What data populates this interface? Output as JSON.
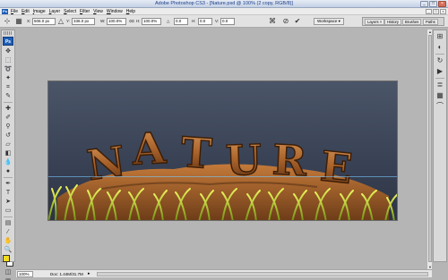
{
  "window": {
    "title": "Adobe Photoshop CS3 - [Nature.psd @ 100% (2 copy, RGB/8)]"
  },
  "menubar": {
    "logo": "Ps",
    "items": [
      "File",
      "Edit",
      "Image",
      "Layer",
      "Select",
      "Filter",
      "View",
      "Window",
      "Help"
    ]
  },
  "options": {
    "x_label": "X:",
    "x_value": "506.0 px",
    "y_label": "Y:",
    "y_value": "336.0 px",
    "w_label": "W:",
    "w_value": "100.0%",
    "h_label": "H:",
    "h_value": "100.0%",
    "angle_label": "△",
    "angle_value": "0.0",
    "hskew_label": "H:",
    "hskew_value": "0.0",
    "vskew_label": "V:",
    "vskew_value": "0.0",
    "workspace_label": "Workspace ▾",
    "panel_tabs": [
      "Layers ×",
      "History",
      "Brushes",
      "Paths"
    ]
  },
  "toolbox": {
    "logo": "Ps"
  },
  "status": {
    "zoom": "100%",
    "doc": "Doc: 1.44M/31.7M",
    "arrow": "▸"
  },
  "canvas": {
    "artwork_text": "NATURE"
  },
  "colors": {
    "foreground": "#f2dc1d",
    "background": "#ffffff",
    "canvas_top": "#4b5568",
    "canvas_bottom": "#2c3344"
  }
}
